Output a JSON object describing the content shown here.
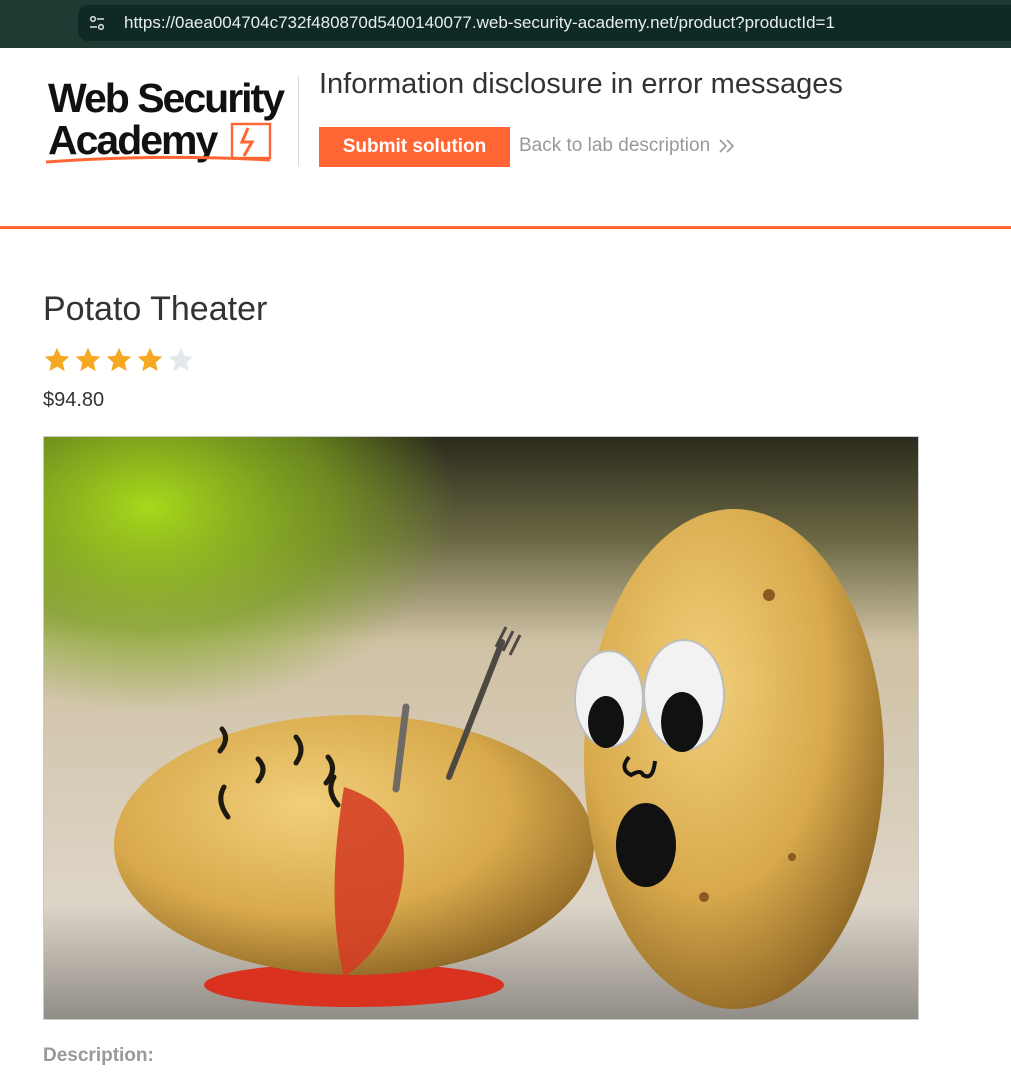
{
  "browser": {
    "url": "https://0aea004704c732f480870d5400140077.web-security-academy.net/product?productId=1",
    "site_info_icon": "tune-icon"
  },
  "header": {
    "logo_text": "Web Security Academy",
    "lab_title": "Information disclosure in error messages",
    "submit_label": "Submit solution",
    "back_label": "Back to lab description",
    "back_icon": "double-chevron-right-icon",
    "accent_color": "#ff6633"
  },
  "product": {
    "title": "Potato Theater",
    "rating": 4,
    "rating_max": 5,
    "price": "$94.80",
    "image_alt": "potato-theater-photo",
    "description_label": "Description:"
  }
}
